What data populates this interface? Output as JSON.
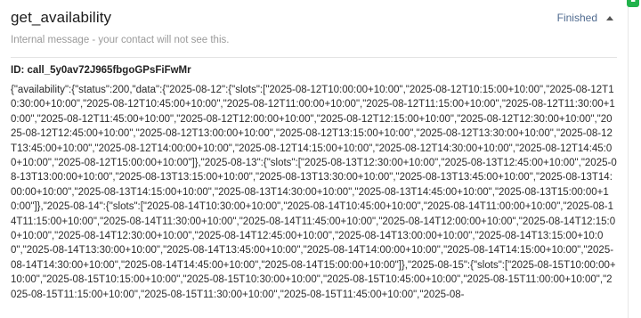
{
  "panel": {
    "title": "get_availability",
    "status": "Finished",
    "note": "Internal message - your contact will not see this.",
    "call_id": "ID: call_5y0av72J965fbgoGPsFiFwMr",
    "payload": "{\"availability\":{\"status\":200,\"data\":{\"2025-08-12\":{\"slots\":[\"2025-08-12T10:00:00+10:00\",\"2025-08-12T10:15:00+10:00\",\"2025-08-12T10:30:00+10:00\",\"2025-08-12T10:45:00+10:00\",\"2025-08-12T11:00:00+10:00\",\"2025-08-12T11:15:00+10:00\",\"2025-08-12T11:30:00+10:00\",\"2025-08-12T11:45:00+10:00\",\"2025-08-12T12:00:00+10:00\",\"2025-08-12T12:15:00+10:00\",\"2025-08-12T12:30:00+10:00\",\"2025-08-12T12:45:00+10:00\",\"2025-08-12T13:00:00+10:00\",\"2025-08-12T13:15:00+10:00\",\"2025-08-12T13:30:00+10:00\",\"2025-08-12T13:45:00+10:00\",\"2025-08-12T14:00:00+10:00\",\"2025-08-12T14:15:00+10:00\",\"2025-08-12T14:30:00+10:00\",\"2025-08-12T14:45:00+10:00\",\"2025-08-12T15:00:00+10:00\"]},\"2025-08-13\":{\"slots\":[\"2025-08-13T12:30:00+10:00\",\"2025-08-13T12:45:00+10:00\",\"2025-08-13T13:00:00+10:00\",\"2025-08-13T13:15:00+10:00\",\"2025-08-13T13:30:00+10:00\",\"2025-08-13T13:45:00+10:00\",\"2025-08-13T14:00:00+10:00\",\"2025-08-13T14:15:00+10:00\",\"2025-08-13T14:30:00+10:00\",\"2025-08-13T14:45:00+10:00\",\"2025-08-13T15:00:00+10:00\"]},\"2025-08-14\":{\"slots\":[\"2025-08-14T10:30:00+10:00\",\"2025-08-14T10:45:00+10:00\",\"2025-08-14T11:00:00+10:00\",\"2025-08-14T11:15:00+10:00\",\"2025-08-14T11:30:00+10:00\",\"2025-08-14T11:45:00+10:00\",\"2025-08-14T12:00:00+10:00\",\"2025-08-14T12:15:00+10:00\",\"2025-08-14T12:30:00+10:00\",\"2025-08-14T12:45:00+10:00\",\"2025-08-14T13:00:00+10:00\",\"2025-08-14T13:15:00+10:00\",\"2025-08-14T13:30:00+10:00\",\"2025-08-14T13:45:00+10:00\",\"2025-08-14T14:00:00+10:00\",\"2025-08-14T14:15:00+10:00\",\"2025-08-14T14:30:00+10:00\",\"2025-08-14T14:45:00+10:00\",\"2025-08-14T15:00:00+10:00\"]},\"2025-08-15\":{\"slots\":[\"2025-08-15T10:00:00+10:00\",\"2025-08-15T10:15:00+10:00\",\"2025-08-15T10:30:00+10:00\",\"2025-08-15T10:45:00+10:00\",\"2025-08-15T11:00:00+10:00\",\"2025-08-15T11:15:00+10:00\",\"2025-08-15T11:30:00+10:00\",\"2025-08-15T11:45:00+10:00\",\"2025-08-"
  },
  "colors": {
    "status": "#4f6a8f",
    "note": "#9a9a9a",
    "badge": "#21b24b"
  },
  "icons": {
    "collapse": "caret-up-icon",
    "corner": "status-badge-icon"
  }
}
